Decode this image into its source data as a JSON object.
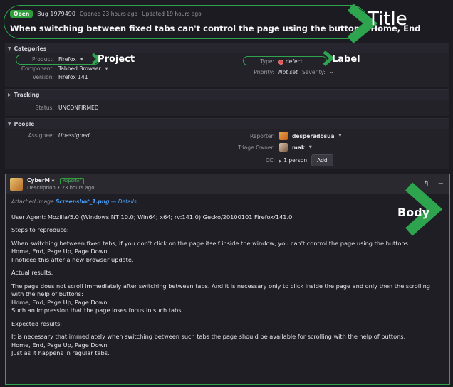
{
  "header": {
    "status": "Open",
    "bug_id": "Bug 1979490",
    "opened": "Opened 23 hours ago",
    "updated": "Updated 19 hours ago",
    "title": "When switching between fixed tabs can't control the page using the buttons: Home, End"
  },
  "categories": {
    "heading": "Categories",
    "product_label": "Product:",
    "product": "Firefox",
    "component_label": "Component:",
    "component": "Tabbed Browser",
    "version_label": "Version:",
    "version": "Firefox 141",
    "type_label": "Type:",
    "type": "defect",
    "priority_label": "Priority:",
    "priority": "Not set",
    "severity_label": "Severity:",
    "severity": "--"
  },
  "tracking": {
    "heading": "Tracking",
    "status_label": "Status:",
    "status": "UNCONFIRMED"
  },
  "people": {
    "heading": "People",
    "assignee_label": "Assignee:",
    "assignee": "Unassigned",
    "reporter_label": "Reporter:",
    "reporter": "desperadosua",
    "triage_label": "Triage Owner:",
    "triage": "mak",
    "cc_label": "CC:",
    "cc": "1 person",
    "add_label": "Add"
  },
  "comment": {
    "user": "CyberM",
    "role": "Reporter",
    "desc": "Description • 23 hours ago",
    "attach_prefix": "Attached image",
    "attach_file": "Screenshot_1.png",
    "attach_details": "— Details",
    "lines": [
      "User Agent: Mozilla/5.0 (Windows NT 10.0; Win64; x64; rv:141.0) Gecko/20100101 Firefox/141.0",
      "Steps to reproduce:",
      "When switching between fixed tabs, if you don't click on the page itself inside the window, you can't control the page using the buttons:",
      "Home, End, Page Up, Page Down.",
      "I noticed this after a new browser update.",
      "Actual results:",
      "The page does not scroll immediately after switching between tabs. And it is necessary only to click inside the page and only then the scrolling with the help of buttons:",
      "Home, End, Page Up, Page Down",
      "Such an impression that the page loses focus in such tabs.",
      "Expected results:",
      "It is necessary that immediately when switching between such tabs the page should be available for scrolling with the help of buttons:",
      "Home, End, Page Up, Page Down",
      "Just as it happens in regular tabs."
    ]
  },
  "annotations": {
    "title": "Title",
    "project": "Project",
    "label": "Label",
    "body": "Body"
  },
  "colors": {
    "accent_green": "#2ea44f",
    "open_badge": "#2e9e3b",
    "defect": "#e05151",
    "link": "#4aa3ff"
  }
}
